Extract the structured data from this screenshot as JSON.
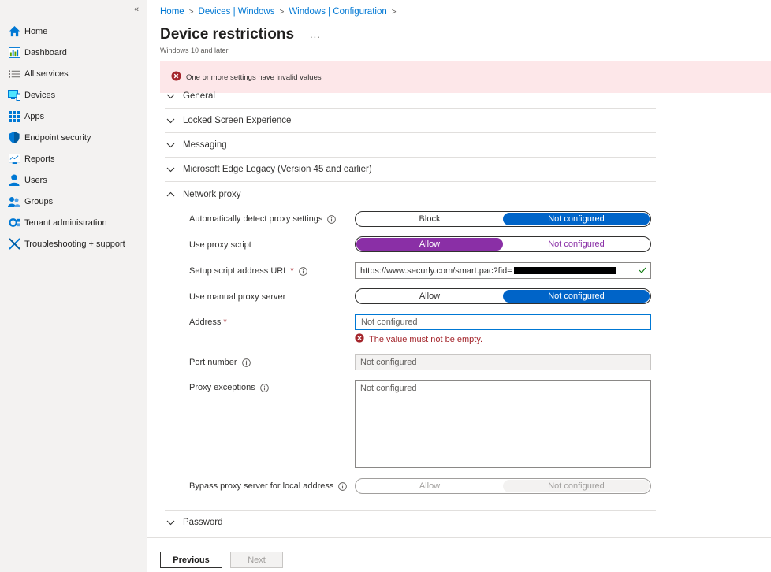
{
  "sidebar": {
    "collapse_label": "«",
    "items": [
      {
        "label": "Home",
        "icon": "home-icon"
      },
      {
        "label": "Dashboard",
        "icon": "dashboard-icon"
      },
      {
        "label": "All services",
        "icon": "list-icon"
      },
      {
        "label": "Devices",
        "icon": "devices-icon"
      },
      {
        "label": "Apps",
        "icon": "apps-icon"
      },
      {
        "label": "Endpoint security",
        "icon": "shield-icon"
      },
      {
        "label": "Reports",
        "icon": "reports-icon"
      },
      {
        "label": "Users",
        "icon": "user-icon"
      },
      {
        "label": "Groups",
        "icon": "groups-icon"
      },
      {
        "label": "Tenant administration",
        "icon": "tenant-icon"
      },
      {
        "label": "Troubleshooting + support",
        "icon": "wrench-icon"
      }
    ]
  },
  "breadcrumb": [
    "Home",
    "Devices | Windows",
    "Windows | Configuration"
  ],
  "header": {
    "title": "Device restrictions",
    "more": "...",
    "subtitle": "Windows 10 and later"
  },
  "banner": {
    "message": "One or more settings have invalid values"
  },
  "sections": {
    "general": "General",
    "locked": "Locked Screen Experience",
    "messaging": "Messaging",
    "edge": "Microsoft Edge Legacy (Version 45 and earlier)",
    "proxy": "Network proxy",
    "password": "Password"
  },
  "proxy": {
    "auto_detect": {
      "label": "Automatically detect proxy settings",
      "left": "Block",
      "right": "Not configured"
    },
    "use_script": {
      "label": "Use proxy script",
      "left": "Allow",
      "right": "Not configured"
    },
    "script_url": {
      "label": "Setup script address URL",
      "required": "*",
      "value": "https://www.securly.com/smart.pac?fid="
    },
    "manual": {
      "label": "Use manual proxy server",
      "left": "Allow",
      "right": "Not configured"
    },
    "address": {
      "label": "Address",
      "required": "*",
      "placeholder": "Not configured",
      "error": "The value must not be empty."
    },
    "port": {
      "label": "Port number",
      "placeholder": "Not configured"
    },
    "exceptions": {
      "label": "Proxy exceptions",
      "placeholder": "Not configured"
    },
    "bypass": {
      "label": "Bypass proxy server for local address",
      "left": "Allow",
      "right": "Not configured"
    }
  },
  "footer": {
    "previous": "Previous",
    "next": "Next"
  },
  "colors": {
    "accent": "#0078d4",
    "selected": "#0064c8",
    "purple": "#8a2fa6",
    "error": "#a4262c",
    "banner_bg": "#fde7e9"
  }
}
